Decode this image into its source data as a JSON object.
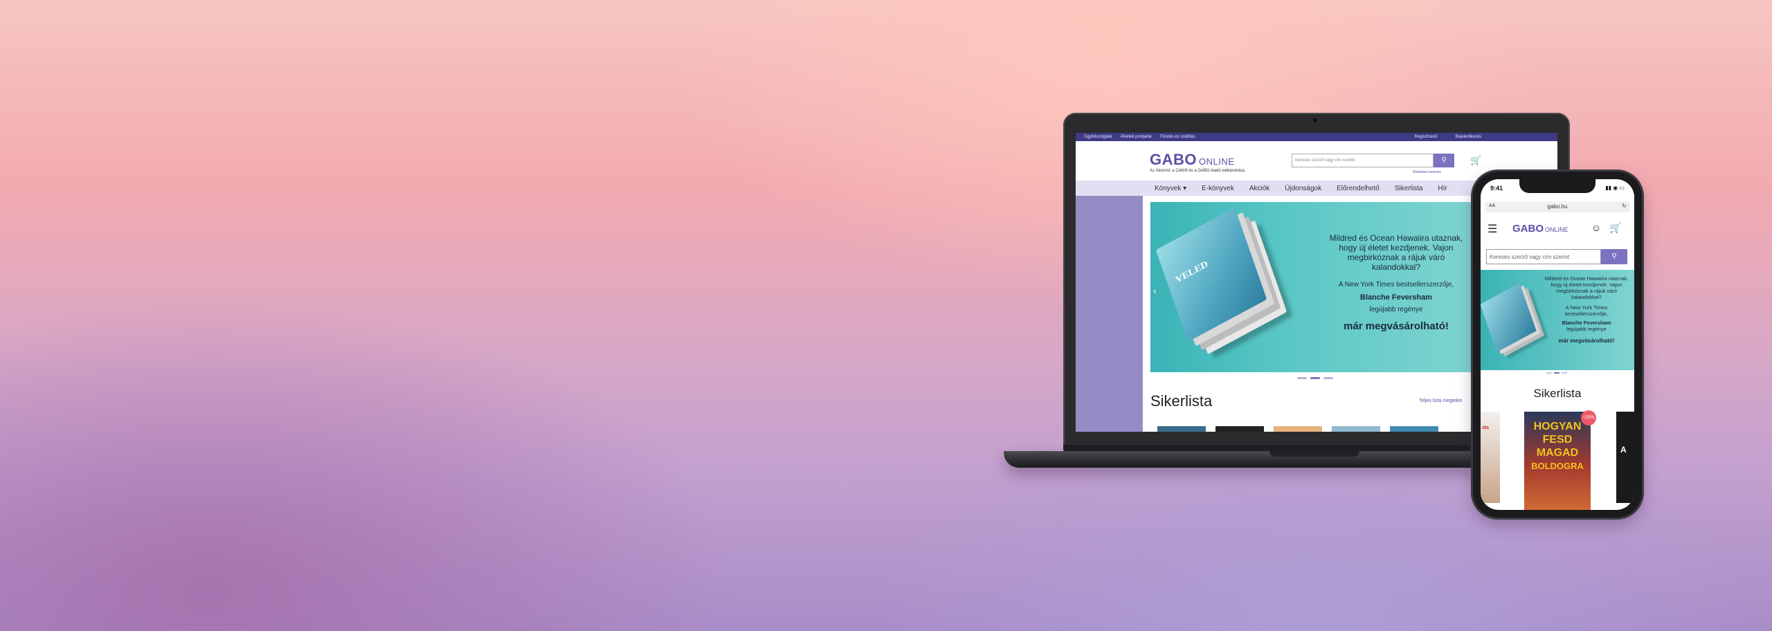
{
  "desktop": {
    "topbar": {
      "links": [
        "Ügyfélszolgálat",
        "Átvételi pontjaink",
        "Fizetés és szállítás"
      ],
      "account": [
        "Regisztráció",
        "Bejelentkezés"
      ]
    },
    "logo": {
      "brand": "GABO",
      "suffix": "ONLINE"
    },
    "tagline": "Az Álomról, a Céltről és a GABO kiadó webáruháza",
    "search": {
      "placeholder": "Keresés szerző vagy cím szerint",
      "advanced": "Részletes keresés"
    },
    "nav": [
      "Könyvek ▾",
      "E-könyvek",
      "Akciók",
      "Újdonságok",
      "Előrendelhető",
      "Sikerlista",
      "Hír"
    ],
    "banner": {
      "book_title": "VELED",
      "line1": "Mildred és Ocean Hawaiira utaznak, hogy új életet kezdjenek. Vajon megbirkóznak a rájuk váró kalandokkal?",
      "line2": "A New York Times bestsellerszerzője,",
      "author": "Blanche Feversham",
      "line3": "legújabb regénye",
      "cta": "már megvásárolható!"
    },
    "section_title": "Sikerlista",
    "section_link": "Teljes lista megtekin"
  },
  "phone": {
    "time": "9:41",
    "url_aa": "AA",
    "domain": "gabo.hu",
    "logo": {
      "brand": "GABO",
      "suffix": "ONLINE"
    },
    "search_placeholder": "Keresés szerző vagy cím szerint",
    "banner": {
      "line1": "Mildred és Ocean Hawaiira utaznak, hogy új életet kezdjenek. Vajon megbirkóznak a rájuk váró kalandokkal?",
      "line2": "A New York Times bestsellerszerzője,",
      "author": "Blanche Feversham",
      "line3": "legújabb regénye",
      "cta": "már megvásárolható!"
    },
    "section_title": "Sikerlista",
    "cover": {
      "line1": "HOGYAN",
      "line2": "FESD",
      "line3": "MAGAD",
      "line4": "BOLDOGRA"
    },
    "badge": "-15%"
  },
  "colors": {
    "brand": "#5a4fa6",
    "topbar": "#3f3a85",
    "accent": "#7b73c0"
  },
  "icons": {
    "search": "search-icon",
    "cart": "cart-icon",
    "menu": "menu-icon",
    "user": "user-icon"
  }
}
